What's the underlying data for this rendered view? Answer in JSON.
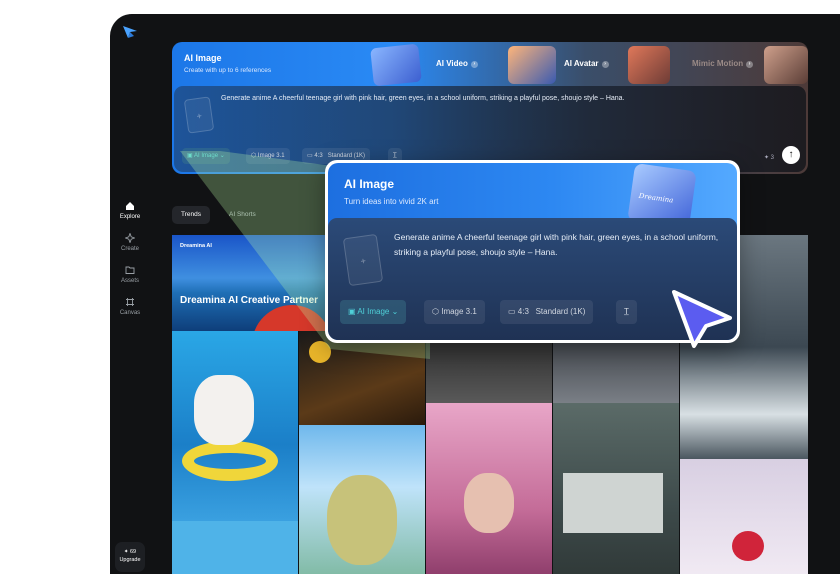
{
  "sidebar": {
    "items": [
      {
        "label": "Explore",
        "icon": "home-icon"
      },
      {
        "label": "Create",
        "icon": "sparkle-icon"
      },
      {
        "label": "Assets",
        "icon": "folder-icon"
      },
      {
        "label": "Canvas",
        "icon": "canvas-icon"
      }
    ],
    "upgrade": {
      "credits": "✦ 69",
      "label": "Upgrade"
    }
  },
  "hero": {
    "title": "AI Image",
    "subtitle": "Create with up to 6 references",
    "tabs": [
      {
        "label": "AI Video"
      },
      {
        "label": "AI Avatar"
      },
      {
        "label": "Mimic Motion"
      }
    ],
    "prompt": "Generate anime A cheerful teenage girl with pink hair, green eyes, in a school uniform, striking a playful pose, shoujo style – Hana.",
    "chips": {
      "mode": "AI Image",
      "model": "Image 3.1",
      "ratio": "4:3",
      "quality": "Standard (1K)"
    },
    "credits": "✦ 3"
  },
  "feed_tabs": [
    "Trends",
    "AI Shorts"
  ],
  "banner": {
    "brand": "Dreamina AI",
    "title": "Dreamina AI Creative Partner"
  },
  "popup": {
    "title": "AI Image",
    "subtitle": "Turn ideas into vivid 2K art",
    "prompt": "Generate anime A cheerful teenage girl with pink hair, green eyes, in a school uniform, striking a playful pose, shoujo style – Hana.",
    "chips": {
      "mode": "AI Image",
      "model": "Image 3.1",
      "ratio": "4:3",
      "quality": "Standard (1K)"
    },
    "thumb_brand": "Dreamina"
  },
  "colors": {
    "accent": "#2a8af5",
    "mode_chip_text": "#4fd0d8",
    "cursor": "#5b5cf0",
    "background": "#111214"
  }
}
